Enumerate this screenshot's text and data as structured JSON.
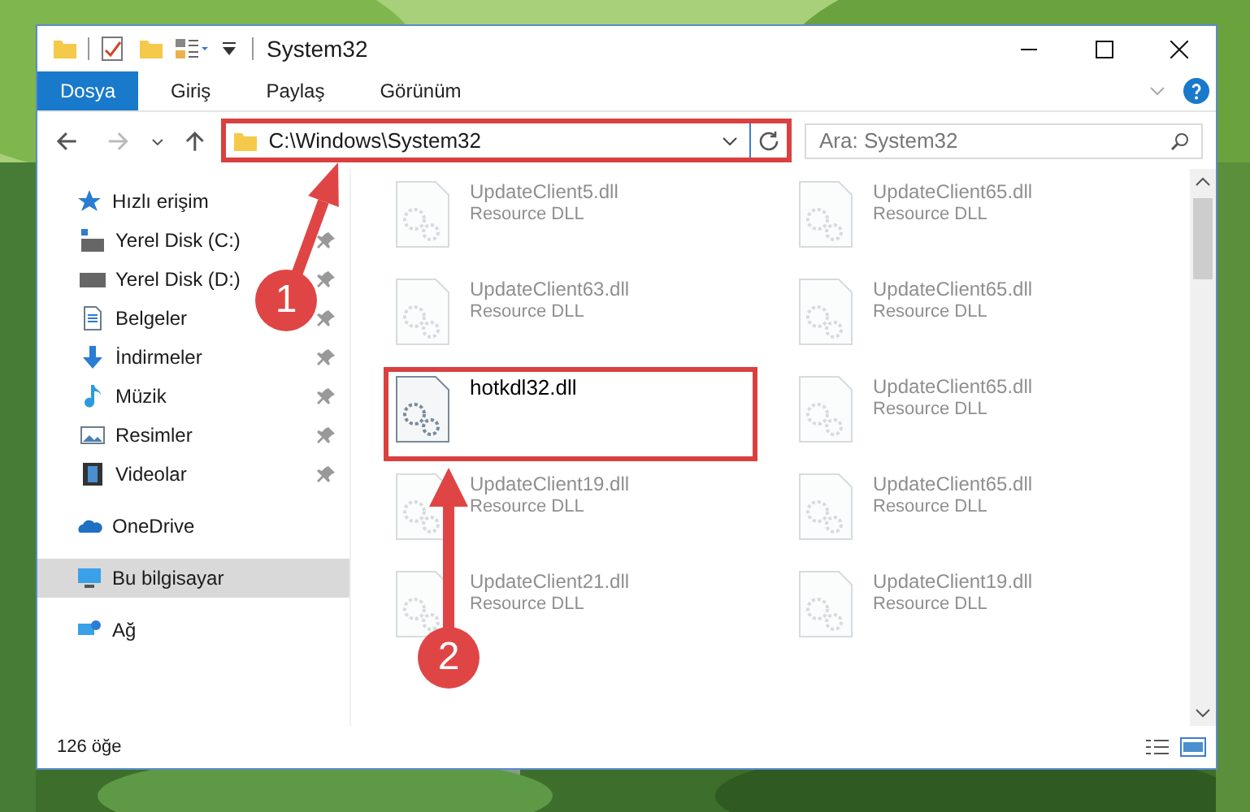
{
  "window": {
    "title": "System32"
  },
  "ribbon_tabs": [
    {
      "label": "Dosya",
      "kind": "file"
    },
    {
      "label": "Giriş",
      "kind": "tab"
    },
    {
      "label": "Paylaş",
      "kind": "tab"
    },
    {
      "label": "Görünüm",
      "kind": "tab"
    }
  ],
  "address": {
    "path": "C:\\Windows\\System32",
    "highlighted": true
  },
  "search": {
    "placeholder": "Ara: System32"
  },
  "sidebar": [
    {
      "label": "Hızlı erişim",
      "kind": "star",
      "selected": false,
      "children": [
        {
          "label": "Yerel Disk (C:)",
          "kind": "sysdisk",
          "pinned": true,
          "selected": false
        },
        {
          "label": "Yerel Disk (D:)",
          "kind": "disk",
          "pinned": true,
          "selected": false
        },
        {
          "label": "Belgeler",
          "kind": "docs",
          "pinned": true,
          "selected": false
        },
        {
          "label": "İndirmeler",
          "kind": "download",
          "pinned": true,
          "selected": false
        },
        {
          "label": "Müzik",
          "kind": "music",
          "pinned": true,
          "selected": false
        },
        {
          "label": "Resimler",
          "kind": "pictures",
          "pinned": true,
          "selected": false
        },
        {
          "label": "Videolar",
          "kind": "videos",
          "pinned": true,
          "selected": false
        }
      ]
    },
    {
      "label": "OneDrive",
      "kind": "cloud",
      "selected": false
    },
    {
      "label": "Bu bilgisayar",
      "kind": "pc",
      "selected": true
    },
    {
      "label": "Ağ",
      "kind": "network",
      "selected": false
    }
  ],
  "files": [
    {
      "name": "UpdateClient5.dll",
      "type": "Resource DLL",
      "highlighted": false
    },
    {
      "name": "UpdateClient65.dll",
      "type": "Resource DLL",
      "highlighted": false
    },
    {
      "name": "UpdateClient63.dll",
      "type": "Resource DLL",
      "highlighted": false
    },
    {
      "name": "UpdateClient65.dll",
      "type": "Resource DLL",
      "highlighted": false
    },
    {
      "name": "hotkdl32.dll",
      "highlighted": true
    },
    {
      "name": "UpdateClient65.dll",
      "type": "Resource DLL",
      "highlighted": false
    },
    {
      "name": "UpdateClient19.dll",
      "type": "Resource DLL",
      "highlighted": false
    },
    {
      "name": "UpdateClient65.dll",
      "type": "Resource DLL",
      "highlighted": false
    },
    {
      "name": "UpdateClient21.dll",
      "type": "Resource DLL",
      "highlighted": false
    },
    {
      "name": "UpdateClient19.dll",
      "type": "Resource DLL",
      "highlighted": false
    }
  ],
  "status_bar": {
    "count": "126 öğe"
  },
  "annotations": [
    {
      "label": "1"
    },
    {
      "label": "2"
    }
  ]
}
